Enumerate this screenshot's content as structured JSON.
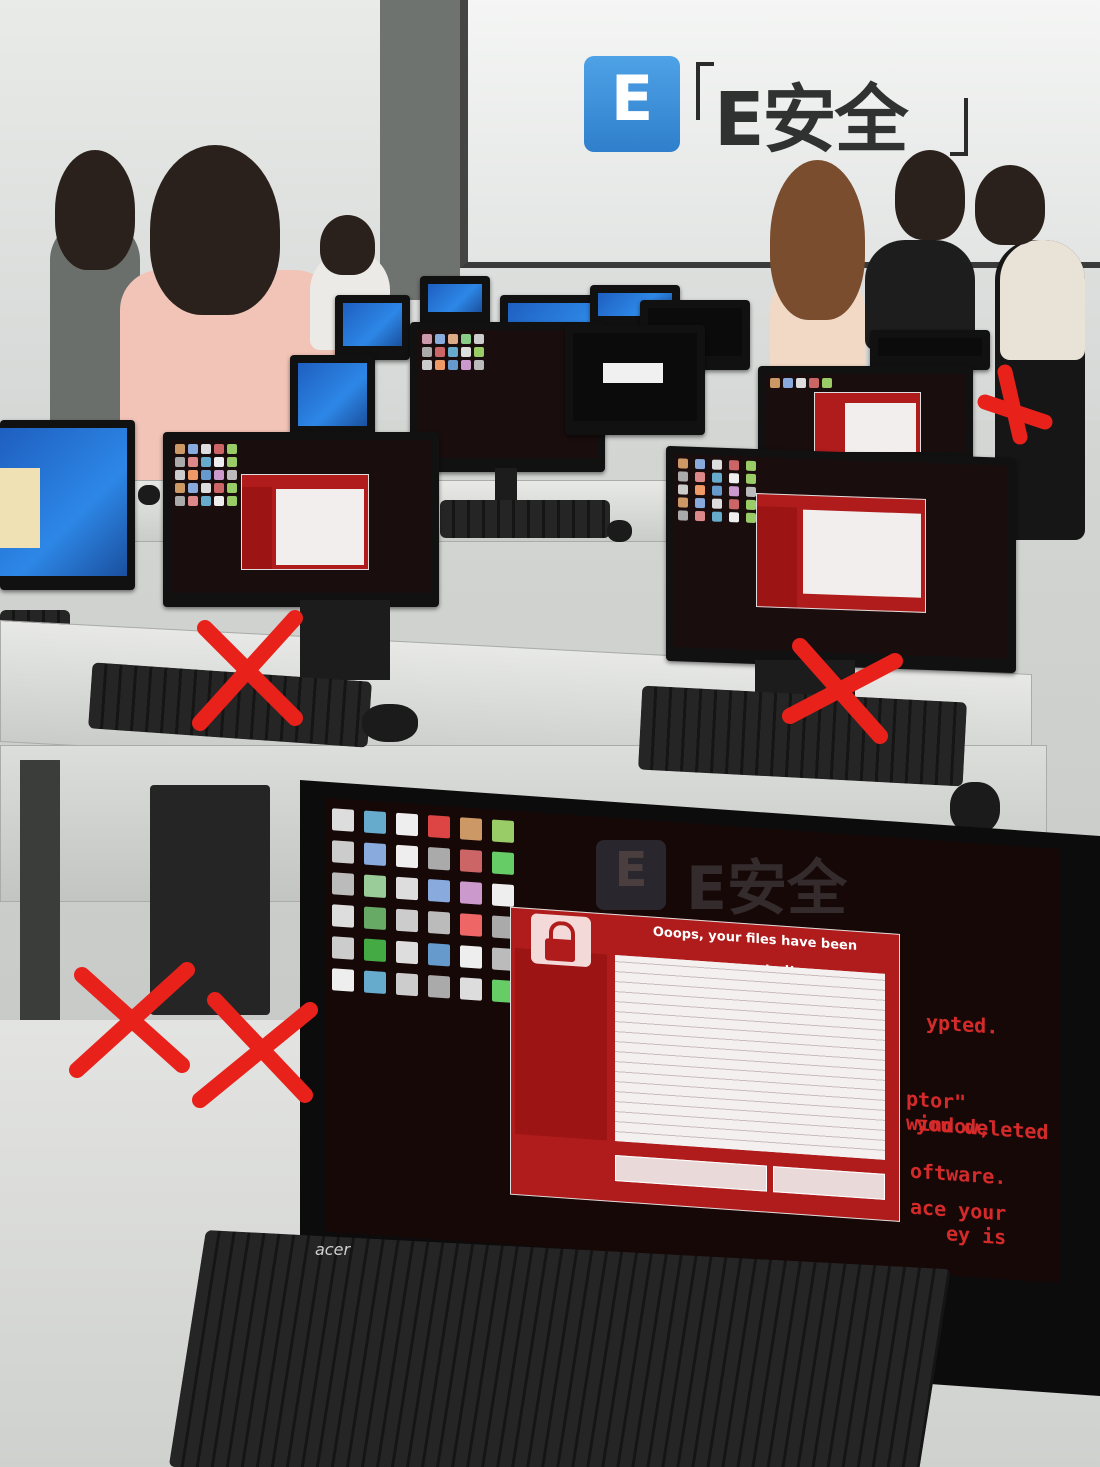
{
  "watermark": {
    "badge_letter": "E",
    "name": "E安全"
  },
  "front_monitor": {
    "window_title": "Ooops, your files have been encrypted!",
    "background_text": [
      "ypted.",
      "ptor\" window,",
      "you deleted",
      "oftware.",
      "ace your",
      "ey is"
    ],
    "brand": "acer"
  },
  "keyboard_brand": "acer",
  "marks": {
    "red_x_count": 6,
    "red_x_color": "#e8221b"
  },
  "colors": {
    "ransom_red": "#b01c1c",
    "screen_blue": "#2d87e6"
  }
}
